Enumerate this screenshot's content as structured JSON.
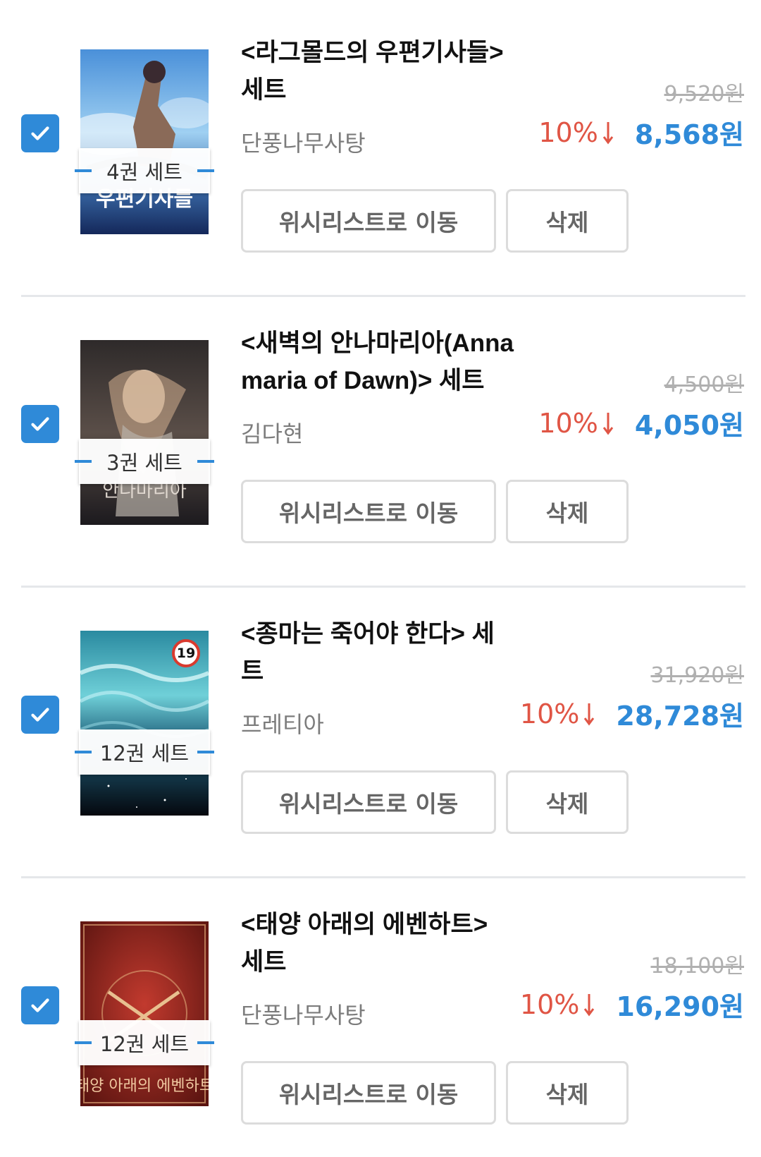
{
  "items": [
    {
      "title_line1": "<라그몰드의 우편기사들>",
      "title_line2": "세트",
      "author": "단풍나무사탕",
      "set_badge": "4권 세트",
      "cover_text": "우편기사들",
      "original_price": "9,520원",
      "discount": "10%",
      "price": "8,568원",
      "checked": true,
      "wishlist_label": "위시리스트로 이동",
      "delete_label": "삭제"
    },
    {
      "title_line1": "<새벽의 안나마리아(Anna",
      "title_line2": "maria of Dawn)> 세트",
      "author": "김다현",
      "set_badge": "3권 세트",
      "cover_text": "안나마리아",
      "original_price": "4,500원",
      "discount": "10%",
      "price": "4,050원",
      "checked": true,
      "wishlist_label": "위시리스트로 이동",
      "delete_label": "삭제"
    },
    {
      "title_line1": "<종마는 죽어야 한다> 세",
      "title_line2": "트",
      "author": "프레티아",
      "set_badge": "12권 세트",
      "age_rating": "19",
      "original_price": "31,920원",
      "discount": "10%",
      "price": "28,728원",
      "checked": true,
      "wishlist_label": "위시리스트로 이동",
      "delete_label": "삭제"
    },
    {
      "title_line1": "<태양 아래의 에벤하트>",
      "title_line2": "세트",
      "author": "단풍나무사탕",
      "set_badge": "12권 세트",
      "cover_text": "태양 아래의 에벤하트",
      "original_price": "18,100원",
      "discount": "10%",
      "price": "16,290원",
      "checked": true,
      "wishlist_label": "위시리스트로 이동",
      "delete_label": "삭제"
    }
  ],
  "colors": {
    "accent": "#2f8ad8",
    "discount": "#e05545",
    "strike": "#b0b0b0",
    "border": "#dcdcdc"
  },
  "icons": {
    "checkbox": "check-icon",
    "discount_arrow": "arrow-down-icon"
  }
}
